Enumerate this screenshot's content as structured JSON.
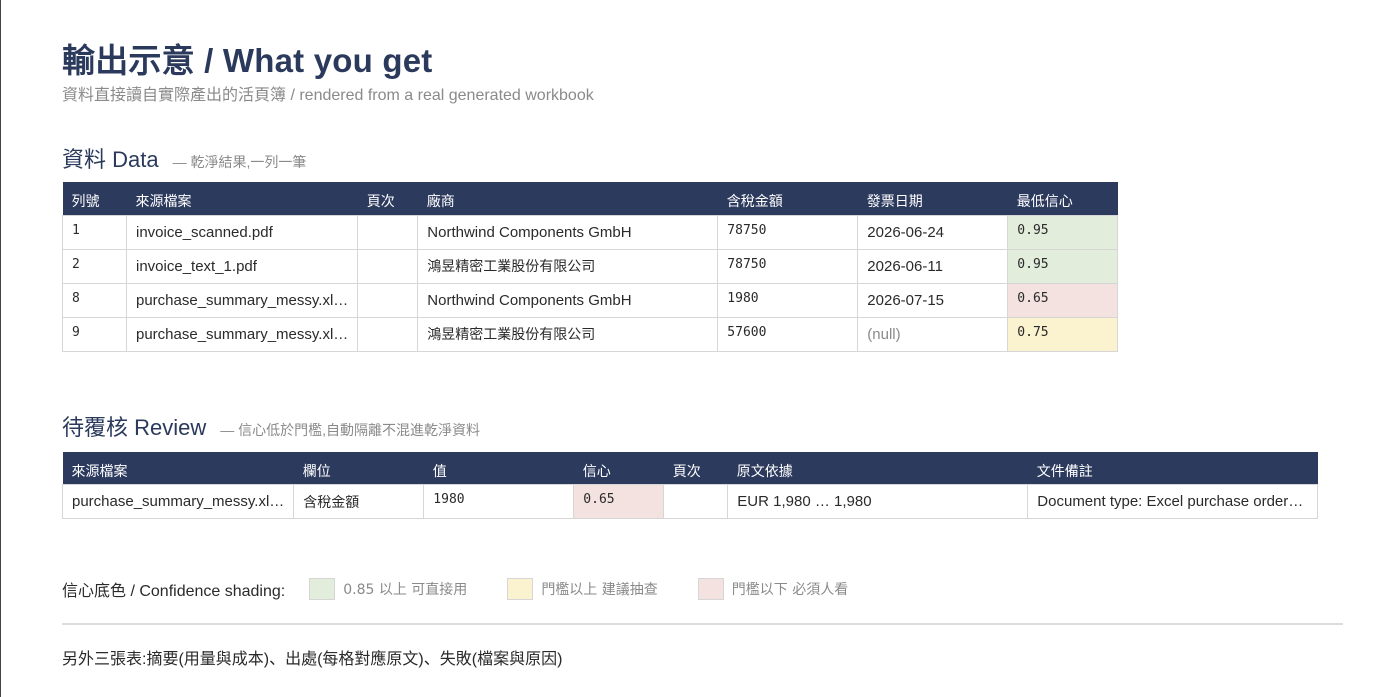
{
  "header": {
    "title": "輸出示意 / What you get",
    "subtitle": "資料直接讀自實際產出的活頁簿 / rendered from a real generated workbook"
  },
  "data_section": {
    "title": "資料 Data",
    "note": "— 乾淨結果,一列一筆",
    "columns": [
      "列號",
      "來源檔案",
      "頁次",
      "廠商",
      "含稅金額",
      "發票日期",
      "最低信心"
    ],
    "rows": [
      {
        "row": "1",
        "source": "invoice_scanned.pdf",
        "page": "",
        "vendor": "Northwind Components GmbH",
        "amount": "78750",
        "date": "2026-06-24",
        "confidence": "0.95",
        "level": "hi"
      },
      {
        "row": "2",
        "source": "invoice_text_1.pdf",
        "page": "",
        "vendor": "鴻昱精密工業股份有限公司",
        "amount": "78750",
        "date": "2026-06-11",
        "confidence": "0.95",
        "level": "hi"
      },
      {
        "row": "8",
        "source": "purchase_summary_messy.xl…",
        "page": "",
        "vendor": "Northwind Components GmbH",
        "amount": "1980",
        "date": "2026-07-15",
        "confidence": "0.65",
        "level": "lo"
      },
      {
        "row": "9",
        "source": "purchase_summary_messy.xl…",
        "page": "",
        "vendor": "鴻昱精密工業股份有限公司",
        "amount": "57600",
        "date": "(null)",
        "confidence": "0.75",
        "level": "mid"
      }
    ]
  },
  "review_section": {
    "title": "待覆核 Review",
    "note": "— 信心低於門檻,自動隔離不混進乾淨資料",
    "columns": [
      "來源檔案",
      "欄位",
      "值",
      "信心",
      "頁次",
      "原文依據",
      "文件備註"
    ],
    "rows": [
      {
        "source": "purchase_summary_messy.xl…",
        "field": "含稅金額",
        "value": "1980",
        "confidence": "0.65",
        "page": "",
        "evidence": "EUR 1,980 … 1,980",
        "note": "Document type: Excel purchase order…",
        "level": "lo"
      }
    ]
  },
  "legend": {
    "label": "信心底色 / Confidence shading:",
    "items": [
      {
        "text": "0.85 以上 可直接用",
        "color": "#e3eddc"
      },
      {
        "text": "門檻以上 建議抽查",
        "color": "#fbf2cf"
      },
      {
        "text": "門檻以下 必須人看",
        "color": "#f3e2e0"
      }
    ]
  },
  "footer": {
    "text": "另外三張表:摘要(用量與成本)、出處(每格對應原文)、失敗(檔案與原因)"
  }
}
